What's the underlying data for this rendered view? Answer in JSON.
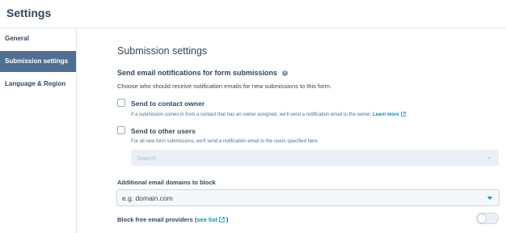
{
  "header": {
    "title": "Settings"
  },
  "sidebar": {
    "items": [
      {
        "label": "General",
        "active": false
      },
      {
        "label": "Submission settings",
        "active": true
      },
      {
        "label": "Language & Region",
        "active": false
      }
    ]
  },
  "main": {
    "title": "Submission settings",
    "notifications": {
      "heading": "Send email notifications for form submissions",
      "description": "Choose who should receive notification emails for new submissions to this form.",
      "options": [
        {
          "label": "Send to contact owner",
          "checked": false,
          "description": "If a submission comes in from a contact that has an owner assigned, we'll send a notification email to the owner.",
          "link": "Learn more"
        },
        {
          "label": "Send to other users",
          "checked": false,
          "description": "For all new form submissions, we'll send a notification email to the users specified here."
        }
      ],
      "users_search": {
        "placeholder": "Search",
        "disabled": true
      }
    },
    "block_domains": {
      "label": "Additional email domains to block",
      "placeholder": "e.g. domain.com"
    },
    "block_free": {
      "label_prefix": "Block free email providers (",
      "link": "see list",
      "label_suffix": ")",
      "enabled": false
    }
  },
  "colors": {
    "text": "#33475b",
    "sidebar_active": "#516f90",
    "link": "#0091ae",
    "border": "#cbd6e2"
  }
}
